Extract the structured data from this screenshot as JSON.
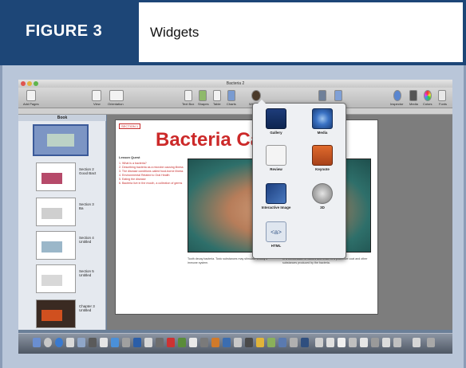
{
  "figure": {
    "label": "FIGURE 3",
    "title": "Widgets"
  },
  "app": {
    "window_title": "Bacteria 2",
    "toolbar": {
      "left": [
        "Add Pages",
        "View",
        "Orientation"
      ],
      "middle": [
        "Text Box",
        "Shapes",
        "Table",
        "Charts",
        "Widgets"
      ],
      "right": [
        "Inspector",
        "Media",
        "Colors",
        "Fonts"
      ]
    },
    "sidebar": {
      "header": "Book",
      "sections": [
        {
          "title": "Section 2",
          "sub": "Good Bact"
        },
        {
          "title": "Section 3",
          "sub": "Ba"
        },
        {
          "title": "Section 4",
          "sub": "Untitled"
        },
        {
          "title": "Section 5",
          "sub": "Untitled"
        },
        {
          "title": "Chapter 3",
          "sub": "Untitled"
        }
      ]
    },
    "page": {
      "chapter_label": "SECTION 1",
      "title": "Bacteria Car",
      "lesson_heading": "Lesson Quest",
      "questions": [
        "1. What is a bacteria?",
        "2. Describing bacteria as a microbe causing illness",
        "3. The disease conditions called food-borne illness",
        "4. Environmental Related to Oral Health",
        "5. Eating the disease",
        "6. Bacteria live in the mouth, a collection of germs"
      ],
      "body_left": "Tooth decay bacteria. Toxic substances may stimulate a body's immune system.",
      "body_right": "In a combination of factors and which is a protective coat and other substances produced by the bacteria."
    },
    "widgets": [
      {
        "label": "Gallery",
        "icon": "gallery-icon"
      },
      {
        "label": "Media",
        "icon": "media-icon"
      },
      {
        "label": "Review",
        "icon": "review-icon"
      },
      {
        "label": "Keynote",
        "icon": "keynote-icon"
      },
      {
        "label": "Interactive Image",
        "icon": "interactive-image-icon"
      },
      {
        "label": "3D",
        "icon": "3d-icon"
      },
      {
        "label": "HTML",
        "icon": "html-icon"
      }
    ]
  },
  "colors": {
    "header_blue": "#1d4677",
    "title_red": "#cc2929",
    "frame": "#b9c6d9"
  }
}
